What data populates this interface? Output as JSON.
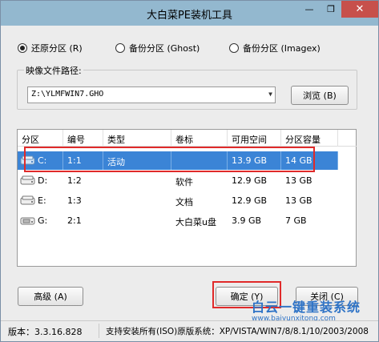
{
  "window": {
    "title": "大白菜PE装机工具",
    "minimize_glyph": "—",
    "maximize_glyph": "❐",
    "close_glyph": "✕"
  },
  "modes": {
    "restore": "还原分区 (R)",
    "backup_ghost": "备份分区 (Ghost)",
    "backup_imagex": "备份分区 (Imagex)",
    "selected": "restore"
  },
  "image_path": {
    "legend": "映像文件路径:",
    "value": "Z:\\YLMFWIN7.GHO",
    "browse_label": "浏览 (B)"
  },
  "partitions": {
    "columns": [
      "分区",
      "编号",
      "类型",
      "卷标",
      "可用空间",
      "分区容量"
    ],
    "rows": [
      {
        "drive": "C:",
        "number": "1:1",
        "type": "活动",
        "label": "",
        "free": "13.9 GB",
        "size": "14 GB"
      },
      {
        "drive": "D:",
        "number": "1:2",
        "type": "",
        "label": "软件",
        "free": "12.9 GB",
        "size": "13 GB"
      },
      {
        "drive": "E:",
        "number": "1:3",
        "type": "",
        "label": "文档",
        "free": "12.9 GB",
        "size": "13 GB"
      },
      {
        "drive": "G:",
        "number": "2:1",
        "type": "",
        "label": "大白菜u盘",
        "free": "3.9 GB",
        "size": "7 GB"
      }
    ],
    "selected_index": 0
  },
  "actions": {
    "advanced_label": "高级 (A)",
    "confirm_label": "确定 (Y)",
    "close_label": "关闭 (C)"
  },
  "status": {
    "version": "版本：3.3.16.828",
    "support": "支持安装所有(ISO)原版系统：XP/VISTA/WIN7/8/8.1/10/2003/2008"
  },
  "watermark": {
    "title": "白云一键重装系统",
    "url": "www.baiyunxitong.com"
  },
  "colors": {
    "selection": "#3b84d6",
    "highlight": "#e02a2a",
    "titlebar": "#93b8cf",
    "close": "#c7504b",
    "watermark": "#2e73c6"
  }
}
